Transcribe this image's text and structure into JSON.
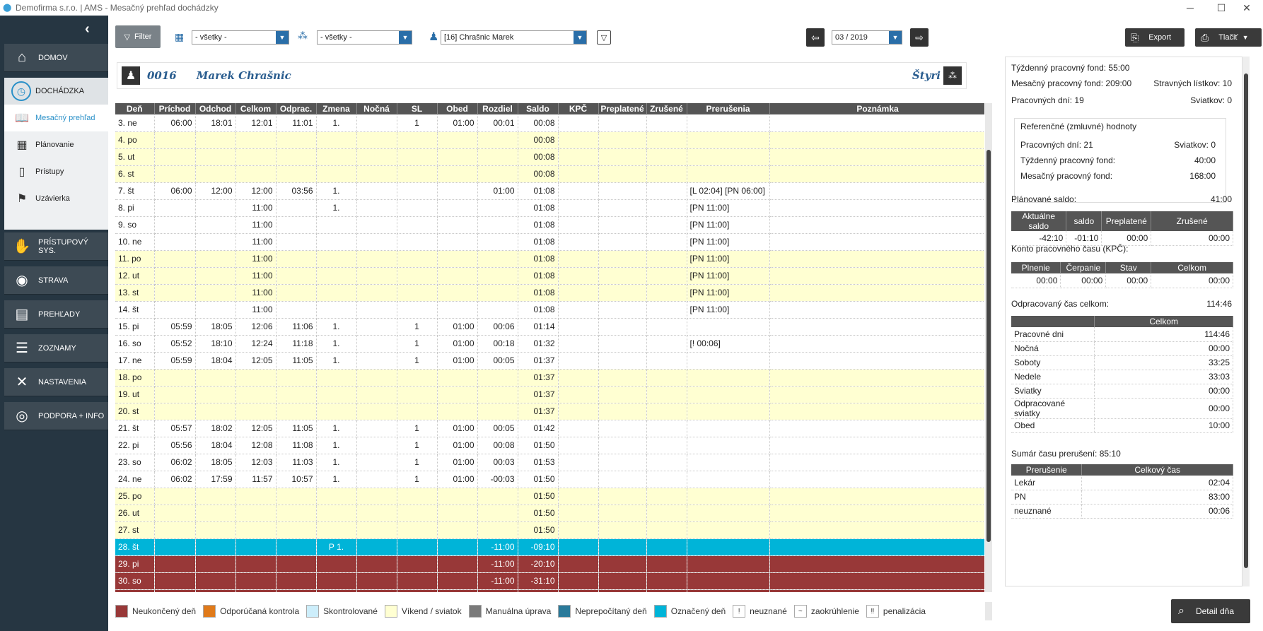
{
  "window": {
    "title": "Demofirma s.r.o. | AMS - Mesačný prehľad dochádzky"
  },
  "sidebar": {
    "domov": "DOMOV",
    "dochadzka": "DOCHÁDZKA",
    "mesacny": "Mesačný prehľad",
    "planovanie": "Plánovanie",
    "pristupy": "Prístupy",
    "uzavierka": "Uzávierka",
    "pristupovy": "PRÍSTUPOVÝ SYS.",
    "strava": "STRAVA",
    "prehlady": "PREHĽADY",
    "zoznamy": "ZOZNAMY",
    "nastavenia": "NASTAVENIA",
    "podpora": "PODPORA + INFO"
  },
  "toolbar": {
    "filter": "Filter",
    "building_select": "- všetky -",
    "group_select": "- všetky -",
    "employee_select": "[16] Chrašnic Marek",
    "month": "03 / 2019",
    "export": "Export",
    "print": "Tlačiť"
  },
  "employee": {
    "id": "0016",
    "name": "Marek Chrašnic",
    "group": "Štyri"
  },
  "grid": {
    "columns": [
      "Deň",
      "Príchod",
      "Odchod",
      "Celkom",
      "Odprac.",
      "Zmena",
      "Nočná",
      "SL",
      "Obed",
      "Rozdiel",
      "Saldo",
      "KPČ",
      "Preplatené",
      "Zrušené",
      "Prerušenia",
      "Poznámka"
    ],
    "rows": [
      {
        "t": "wk",
        "c": [
          "3. ne",
          "06:00",
          "18:01",
          "12:01",
          "11:01",
          "1.",
          "",
          "1",
          "01:00",
          "00:01",
          "00:08",
          "",
          "",
          "",
          "",
          ""
        ]
      },
      {
        "t": "we",
        "c": [
          "4. po",
          "",
          "",
          "",
          "",
          "",
          "",
          "",
          "",
          "",
          "00:08",
          "",
          "",
          "",
          "",
          ""
        ]
      },
      {
        "t": "we",
        "c": [
          "5. ut",
          "",
          "",
          "",
          "",
          "",
          "",
          "",
          "",
          "",
          "00:08",
          "",
          "",
          "",
          "",
          ""
        ]
      },
      {
        "t": "we",
        "c": [
          "6. st",
          "",
          "",
          "",
          "",
          "",
          "",
          "",
          "",
          "",
          "00:08",
          "",
          "",
          "",
          "",
          ""
        ]
      },
      {
        "t": "wk",
        "c": [
          "7. št",
          "06:00",
          "12:00",
          "12:00",
          "03:56",
          "1.",
          "",
          "",
          "",
          "01:00",
          "01:08",
          "",
          "",
          "",
          "[L 02:04] [PN 06:00]",
          ""
        ]
      },
      {
        "t": "wk",
        "c": [
          "8. pi",
          "",
          "",
          "11:00",
          "",
          "1.",
          "",
          "",
          "",
          "",
          "01:08",
          "",
          "",
          "",
          "[PN 11:00]",
          ""
        ]
      },
      {
        "t": "wk",
        "c": [
          "9. so",
          "",
          "",
          "11:00",
          "",
          "",
          "",
          "",
          "",
          "",
          "01:08",
          "",
          "",
          "",
          "[PN 11:00]",
          ""
        ]
      },
      {
        "t": "wk",
        "c": [
          "10. ne",
          "",
          "",
          "11:00",
          "",
          "",
          "",
          "",
          "",
          "",
          "01:08",
          "",
          "",
          "",
          "[PN 11:00]",
          ""
        ]
      },
      {
        "t": "we",
        "c": [
          "11. po",
          "",
          "",
          "11:00",
          "",
          "",
          "",
          "",
          "",
          "",
          "01:08",
          "",
          "",
          "",
          "[PN 11:00]",
          ""
        ]
      },
      {
        "t": "we",
        "c": [
          "12. ut",
          "",
          "",
          "11:00",
          "",
          "",
          "",
          "",
          "",
          "",
          "01:08",
          "",
          "",
          "",
          "[PN 11:00]",
          ""
        ]
      },
      {
        "t": "we",
        "c": [
          "13. st",
          "",
          "",
          "11:00",
          "",
          "",
          "",
          "",
          "",
          "",
          "01:08",
          "",
          "",
          "",
          "[PN 11:00]",
          ""
        ]
      },
      {
        "t": "wk",
        "c": [
          "14. št",
          "",
          "",
          "11:00",
          "",
          "",
          "",
          "",
          "",
          "",
          "01:08",
          "",
          "",
          "",
          "[PN 11:00]",
          ""
        ]
      },
      {
        "t": "wk",
        "c": [
          "15. pi",
          "05:59",
          "18:05",
          "12:06",
          "11:06",
          "1.",
          "",
          "1",
          "01:00",
          "00:06",
          "01:14",
          "",
          "",
          "",
          "",
          ""
        ]
      },
      {
        "t": "wk",
        "c": [
          "16. so",
          "05:52",
          "18:10",
          "12:24",
          "11:18",
          "1.",
          "",
          "1",
          "01:00",
          "00:18",
          "01:32",
          "",
          "",
          "",
          "[! 00:06]",
          ""
        ]
      },
      {
        "t": "wk",
        "c": [
          "17. ne",
          "05:59",
          "18:04",
          "12:05",
          "11:05",
          "1.",
          "",
          "1",
          "01:00",
          "00:05",
          "01:37",
          "",
          "",
          "",
          "",
          ""
        ]
      },
      {
        "t": "we",
        "c": [
          "18. po",
          "",
          "",
          "",
          "",
          "",
          "",
          "",
          "",
          "",
          "01:37",
          "",
          "",
          "",
          "",
          ""
        ]
      },
      {
        "t": "we",
        "c": [
          "19. ut",
          "",
          "",
          "",
          "",
          "",
          "",
          "",
          "",
          "",
          "01:37",
          "",
          "",
          "",
          "",
          ""
        ]
      },
      {
        "t": "we",
        "c": [
          "20. st",
          "",
          "",
          "",
          "",
          "",
          "",
          "",
          "",
          "",
          "01:37",
          "",
          "",
          "",
          "",
          ""
        ]
      },
      {
        "t": "wk",
        "c": [
          "21. št",
          "05:57",
          "18:02",
          "12:05",
          "11:05",
          "1.",
          "",
          "1",
          "01:00",
          "00:05",
          "01:42",
          "",
          "",
          "",
          "",
          ""
        ]
      },
      {
        "t": "wk",
        "c": [
          "22. pi",
          "05:56",
          "18:04",
          "12:08",
          "11:08",
          "1.",
          "",
          "1",
          "01:00",
          "00:08",
          "01:50",
          "",
          "",
          "",
          "",
          ""
        ]
      },
      {
        "t": "wk",
        "c": [
          "23. so",
          "06:02",
          "18:05",
          "12:03",
          "11:03",
          "1.",
          "",
          "1",
          "01:00",
          "00:03",
          "01:53",
          "",
          "",
          "",
          "",
          ""
        ]
      },
      {
        "t": "wk",
        "c": [
          "24. ne",
          "06:02",
          "17:59",
          "11:57",
          "10:57",
          "1.",
          "",
          "1",
          "01:00",
          "-00:03",
          "01:50",
          "",
          "",
          "",
          "",
          ""
        ]
      },
      {
        "t": "we",
        "c": [
          "25. po",
          "",
          "",
          "",
          "",
          "",
          "",
          "",
          "",
          "",
          "01:50",
          "",
          "",
          "",
          "",
          ""
        ]
      },
      {
        "t": "we",
        "c": [
          "26. ut",
          "",
          "",
          "",
          "",
          "",
          "",
          "",
          "",
          "",
          "01:50",
          "",
          "",
          "",
          "",
          ""
        ]
      },
      {
        "t": "we",
        "c": [
          "27. st",
          "",
          "",
          "",
          "",
          "",
          "",
          "",
          "",
          "",
          "01:50",
          "",
          "",
          "",
          "",
          ""
        ]
      },
      {
        "t": "mk",
        "c": [
          "28. št",
          "",
          "",
          "",
          "",
          "P 1.",
          "",
          "",
          "",
          "-11:00",
          "-09:10",
          "",
          "",
          "",
          "",
          ""
        ]
      },
      {
        "t": "uf",
        "c": [
          "29. pi",
          "",
          "",
          "",
          "",
          "",
          "",
          "",
          "",
          "-11:00",
          "-20:10",
          "",
          "",
          "",
          "",
          ""
        ]
      },
      {
        "t": "uf",
        "c": [
          "30. so",
          "",
          "",
          "",
          "",
          "",
          "",
          "",
          "",
          "-11:00",
          "-31:10",
          "",
          "",
          "",
          "",
          ""
        ]
      },
      {
        "t": "uf",
        "c": [
          "",
          "",
          "",
          "",
          "",
          "",
          "",
          "",
          "",
          "",
          "",
          "",
          "",
          "",
          "",
          ""
        ]
      }
    ]
  },
  "legend": [
    {
      "label": "Neukončený deň",
      "color": "#983838",
      "sym": ""
    },
    {
      "label": "Odporúčaná kontrola",
      "color": "#e07a1a",
      "sym": ""
    },
    {
      "label": "Skontrolované",
      "color": "#cdeefb",
      "sym": ""
    },
    {
      "label": "Víkend / sviatok",
      "color": "#ffffd2",
      "sym": ""
    },
    {
      "label": "Manuálna úprava",
      "color": "#7a7a7a",
      "sym": ""
    },
    {
      "label": "Neprepočítaný deň",
      "color": "#2a7a9a",
      "sym": ""
    },
    {
      "label": "Označený deň",
      "color": "#00b4d8",
      "sym": ""
    },
    {
      "label": "neuznané",
      "color": "#ffffff",
      "sym": "!"
    },
    {
      "label": "zaokrúhlenie",
      "color": "#ffffff",
      "sym": "~"
    },
    {
      "label": "penalizácia",
      "color": "#ffffff",
      "sym": "‼"
    }
  ],
  "right": {
    "weekly_fund_label": "Týždenný pracovný fond:",
    "weekly_fund": "55:00",
    "monthly_fund_label": "Mesačný pracovný fond:",
    "monthly_fund": "209:00",
    "meal_label": "Stravných lístkov:",
    "meal": "10",
    "workdays_label": "Pracovných dní:",
    "workdays": "19",
    "holidays_label": "Sviatkov:",
    "holidays": "0",
    "ref_title": "Referenčné (zmluvné) hodnoty",
    "ref_workdays_label": "Pracovných dní:",
    "ref_workdays": "21",
    "ref_holidays_label": "Sviatkov:",
    "ref_holidays": "0",
    "ref_weekly_label": "Týždenný pracovný fond:",
    "ref_weekly": "40:00",
    "ref_monthly_label": "Mesačný pracovný fond:",
    "ref_monthly": "168:00",
    "planned_label": "Plánované saldo:",
    "planned": "41:00",
    "saldo_headers": [
      "Aktuálne saldo",
      "saldo",
      "Preplatené",
      "Zrušené"
    ],
    "saldo_values": [
      "-42:10",
      "-01:10",
      "00:00",
      "00:00"
    ],
    "kpc_title": "Konto pracovného času (KPČ):",
    "kpc_headers": [
      "Plnenie",
      "Čerpanie",
      "Stav",
      "Celkom"
    ],
    "kpc_values": [
      "00:00",
      "00:00",
      "00:00",
      "00:00"
    ],
    "worked_label": "Odpracovaný čas celkom:",
    "worked": "114:46",
    "worked_header": "Celkom",
    "worked_rows": [
      [
        "Pracovné dni",
        "114:46"
      ],
      [
        "Nočná",
        "00:00"
      ],
      [
        "Soboty",
        "33:25"
      ],
      [
        "Nedele",
        "33:03"
      ],
      [
        "Sviatky",
        "00:00"
      ],
      [
        "Odpracované sviatky",
        "00:00"
      ],
      [
        "Obed",
        "10:00"
      ]
    ],
    "breaks_label": "Sumár času prerušení:",
    "breaks": "85:10",
    "breaks_headers": [
      "Prerušenie",
      "Celkový čas"
    ],
    "breaks_rows": [
      [
        "Lekár",
        "02:04"
      ],
      [
        "PN",
        "83:00"
      ],
      [
        "neuznané",
        "00:06"
      ]
    ],
    "detail_button": "Detail dňa"
  }
}
